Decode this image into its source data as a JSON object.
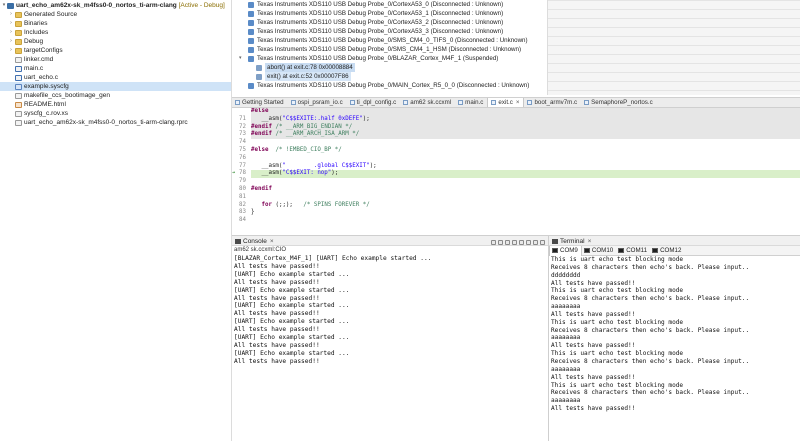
{
  "explorer": {
    "root": {
      "name": "uart_echo_am62x-sk_m4fss0-0_nortos_ti-arm-clang",
      "tag": "[Active - Debug]"
    },
    "items": [
      {
        "label": "Generated Source",
        "kind": "folder"
      },
      {
        "label": "Binaries",
        "kind": "folder"
      },
      {
        "label": "Includes",
        "kind": "folder"
      },
      {
        "label": "Debug",
        "kind": "folder"
      },
      {
        "label": "targetConfigs",
        "kind": "folder"
      },
      {
        "label": "linker.cmd",
        "kind": "file"
      },
      {
        "label": "main.c",
        "kind": "file-c"
      },
      {
        "label": "uart_echo.c",
        "kind": "file-c"
      },
      {
        "label": "example.syscfg",
        "kind": "file-cfg"
      },
      {
        "label": "makefile_ccs_bootimage_gen",
        "kind": "file"
      },
      {
        "label": "README.html",
        "kind": "file-html"
      },
      {
        "label": "syscfg_c.rov.xs",
        "kind": "file"
      },
      {
        "label": "uart_echo_am62x-sk_m4fss0-0_nortos_ti-arm-clang.rprc",
        "kind": "file"
      }
    ]
  },
  "debug": {
    "rows": [
      "Texas Instruments XDS110 USB Debug Probe_0/CortexA53_0 (Disconnected : Unknown)",
      "Texas Instruments XDS110 USB Debug Probe_0/CortexA53_1 (Disconnected : Unknown)",
      "Texas Instruments XDS110 USB Debug Probe_0/CortexA53_2 (Disconnected : Unknown)",
      "Texas Instruments XDS110 USB Debug Probe_0/CortexA53_3 (Disconnected : Unknown)",
      "Texas Instruments XDS110 USB Debug Probe_0/SMS_CM4_0_TIFS_0 (Disconnected : Unknown)",
      "Texas Instruments XDS110 USB Debug Probe_0/SMS_CM4_1_HSM (Disconnected : Unknown)",
      "Texas Instruments XDS110 USB Debug Probe_0/BLAZAR_Cortex_M4F_1 (Suspended)"
    ],
    "frames": [
      "abort() at exit.c:78 0x00008884",
      "exit() at exit.c:52 0x00007F86"
    ],
    "after": [
      "Texas Instruments XDS110 USB Debug Probe_0/MAIN_Cortex_R5_0_0 (Disconnected : Unknown)"
    ]
  },
  "editor": {
    "tabs": [
      {
        "label": "Getting Started",
        "active": false
      },
      {
        "label": "ospi_psram_io.c",
        "active": false
      },
      {
        "label": "ti_dpl_config.c",
        "active": false
      },
      {
        "label": "am62 sk.ccxml",
        "active": false
      },
      {
        "label": "main.c",
        "active": false
      },
      {
        "label": "exit.c",
        "active": true
      },
      {
        "label": "boot_armv7m.c",
        "active": false
      },
      {
        "label": "SemaphoreP_nortos.c",
        "active": false
      }
    ],
    "close_glyph": "×"
  },
  "console": {
    "title": "Console",
    "close_glyph": "×",
    "subtitle": "am62 sk.ccxml:CIO",
    "lines": [
      "[BLAZAR_Cortex_M4F_1] [UART] Echo example started ...",
      "All tests have passed!!",
      "[UART] Echo example started ...",
      "All tests have passed!!",
      "[UART] Echo example started ...",
      "All tests have passed!!",
      "[UART] Echo example started ...",
      "All tests have passed!!",
      "[UART] Echo example started ...",
      "All tests have passed!!",
      "[UART] Echo example started ...",
      "All tests have passed!!",
      "[UART] Echo example started ...",
      "All tests have passed!!"
    ]
  },
  "terminal": {
    "title": "Terminal",
    "close_glyph": "×",
    "tabs": [
      {
        "label": "COM9",
        "active": true
      },
      {
        "label": "COM10",
        "active": false
      },
      {
        "label": "COM11",
        "active": false
      },
      {
        "label": "COM12",
        "active": false
      }
    ],
    "lines": [
      "This is uart echo test blocking mode",
      "Receives 8 characters then echo's back. Please input..",
      "dddddddd",
      "All tests have passed!!",
      "This is uart echo test blocking mode",
      "Receives 8 characters then echo's back. Please input..",
      "aaaaaaaa",
      "All tests have passed!!",
      "This is uart echo test blocking mode",
      "Receives 8 characters then echo's back. Please input..",
      "aaaaaaaa",
      "All tests have passed!!",
      "This is uart echo test blocking mode",
      "Receives 8 characters then echo's back. Please input..",
      "aaaaaaaa",
      "All tests have passed!!",
      "This is uart echo test blocking mode",
      "Receives 8 characters then echo's back. Please input..",
      "aaaaaaaa",
      "All tests have passed!!"
    ]
  }
}
